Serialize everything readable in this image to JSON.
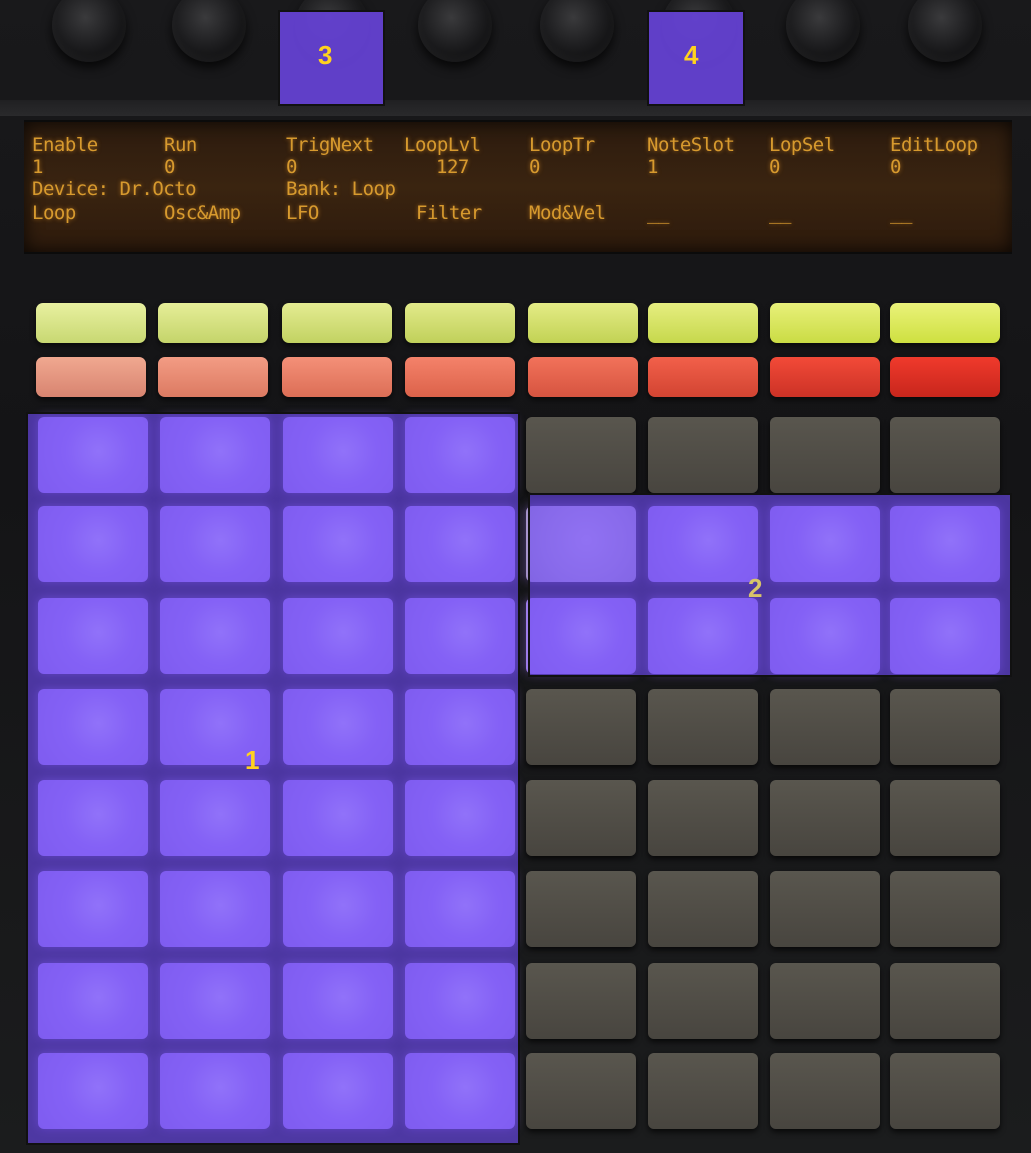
{
  "lcd": {
    "row1": [
      "Enable",
      "Run",
      "TrigNext",
      "LoopLvl",
      "LoopTr",
      "NoteSlot",
      "LopSel",
      "EditLoop"
    ],
    "row2": [
      "1",
      "0",
      "0",
      "127",
      "0",
      "1",
      "0",
      "0"
    ],
    "device": "Device: Dr.Octo",
    "bank": "Bank: Loop",
    "row4": [
      "Loop",
      "Osc&Amp",
      "LFO",
      "Filter",
      "Mod&Vel",
      "__",
      "__",
      "__"
    ]
  },
  "annotations": {
    "label_1": "1",
    "label_2": "2",
    "label_3": "3",
    "label_4": "4"
  },
  "colors": {
    "overlay": "#6e4bf5",
    "label": "#ffd21e",
    "lcd_text": "#d79a2e"
  }
}
